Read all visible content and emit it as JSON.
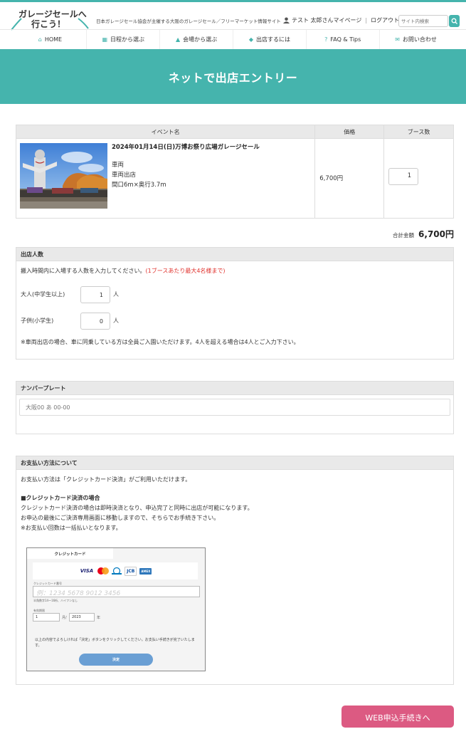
{
  "header": {
    "logo_line1": "ガレージセールへ",
    "logo_line2": "行こう！",
    "tagline": "日本ガレージセール協会が主催する大阪のガレージセール／フリーマーケット情報サイト",
    "user_label": "テスト 太郎さんマイページ",
    "logout": "ログアウト",
    "search_placeholder": "サイト内検索"
  },
  "nav": {
    "items": [
      {
        "label": "HOME",
        "icon": "home-icon"
      },
      {
        "label": "日程から選ぶ",
        "icon": "calendar-icon"
      },
      {
        "label": "会場から選ぶ",
        "icon": "building-icon"
      },
      {
        "label": "出店するには",
        "icon": "tag-icon"
      },
      {
        "label": "FAQ & Tips",
        "icon": "question-icon"
      },
      {
        "label": "お問い合わせ",
        "icon": "mail-icon"
      }
    ]
  },
  "hero": {
    "title": "ネットで出店エントリー"
  },
  "cart": {
    "headers": {
      "event": "イベント名",
      "price": "価格",
      "booths": "ブース数"
    },
    "event_title": "2024年01月14日(日)万博お祭り広場ガレージセール",
    "detail1": "車両",
    "detail2": "車両出店",
    "detail3": "間口6m×奥行3.7m",
    "price": "6,700円",
    "booths": "1"
  },
  "total": {
    "label": "合計金額",
    "value": "6,700円"
  },
  "people": {
    "title": "出店人数",
    "intro": "搬入時間内に入場する人数を入力してください。",
    "intro_red": "(1ブースあたり最大4名様まで)",
    "adult_label": "大人(中学生以上)",
    "adult_value": "1",
    "child_label": "子供(小学生)",
    "child_value": "0",
    "unit": "人",
    "note": "※車両出店の場合、車に同乗している方は全員ご入園いただけます。4人を超える場合は4人とご入力下さい。"
  },
  "plate": {
    "title": "ナンバープレート",
    "placeholder": "大阪00 あ 00-00"
  },
  "payment": {
    "title": "お支払い方法について",
    "line1": "お支払い方法は「クレジットカード決済」がご利用いただけます。",
    "subhead": "■クレジットカード決済の場合",
    "line2": "クレジットカード決済の場合は即時決済となり、申込完了と同時に出店が可能になります。",
    "line3": "お申込の最後にご決済専用画面に移動しますので、そちらでお手続き下さい。",
    "line4": "※お支払い回数は一括払いとなります。",
    "cc": {
      "tab": "クレジットカード",
      "brands": [
        "VISA",
        "Mastercard",
        "Diners",
        "JCB",
        "AMEX"
      ],
      "number_label": "クレジットカード番号",
      "number_placeholder": "例：1234 5678 9012 3456",
      "number_hint": "半角数字14〜16桁、ハイフンなし",
      "expiry_label": "有効期限",
      "month": "1",
      "month_unit": "月/",
      "year": "2023",
      "year_unit": "年",
      "note": "以上の内容でよろしければ「決定」ボタンをクリックしてください。お支払い手続きが完了いたします。",
      "submit": "決定"
    }
  },
  "web_button": "WEB申込手続きへ",
  "colors": {
    "teal": "#45b4ad",
    "pink": "#dc5a82",
    "red": "#e0322d"
  }
}
